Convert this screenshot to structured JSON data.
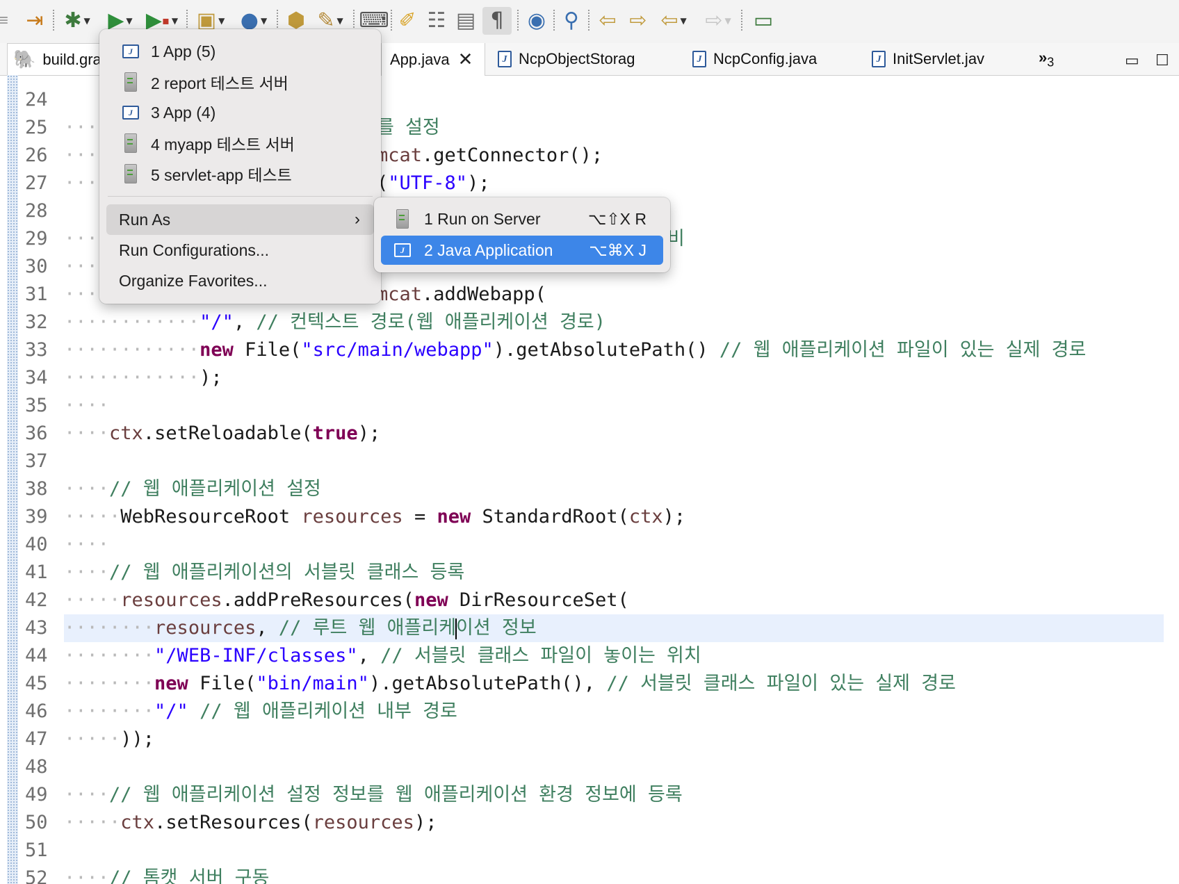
{
  "toolbar": {
    "buttons": [
      "skip-all-breakpoints-icon",
      "debug-icon",
      "run-icon",
      "run-external-tools-icon",
      "new-java-package-icon",
      "new-java-class-icon",
      "open-type-icon",
      "search-icon",
      "open-console-icon",
      "toggle-mark-occurrences-icon",
      "next-annotation-icon",
      "show-block-selection-icon",
      "show-whitespace-icon",
      "web-browser-icon",
      "pin-editor-icon",
      "last-edit-location-icon",
      "back-icon",
      "forward-icon"
    ]
  },
  "tabs": [
    {
      "label": "build.gra",
      "icon": "gradle-elephant-icon"
    },
    {
      "label": "App.java",
      "icon": "java-file-icon",
      "active": true
    },
    {
      "label": "NcpObjectStorag",
      "icon": "java-file-icon"
    },
    {
      "label": "NcpConfig.java",
      "icon": "java-file-icon"
    },
    {
      "label": "InitServlet.jav",
      "icon": "java-file-icon"
    }
  ],
  "tab_overflow": {
    "glyph": "»",
    "count": "3"
  },
  "editor": {
    "line_numbers": [
      "24",
      "25",
      "26",
      "27",
      "28",
      "29",
      "30",
      "31",
      "32",
      "33",
      "34",
      "35",
      "36",
      "37",
      "38",
      "39",
      "40",
      "41",
      "42",
      "43",
      "44",
      "45",
      "46",
      "47",
      "48",
      "49",
      "50",
      "51",
      "52"
    ],
    "peek": {
      "l25": "를 설정",
      "l26a": "mcat",
      "l26b": ".getConnector();",
      "l27a": "(",
      "l27b": "\"UTF-8\"",
      "l27c": ");",
      "l29": "비",
      "l31a": "mcat",
      "l31b": ".addWebapp("
    },
    "l32": {
      "s": "\"/\"",
      "p": ", ",
      "c": "// 컨텍스트 경로(웹 애플리케이션 경로)"
    },
    "l33": {
      "k": "new",
      "a": " File(",
      "s": "\"src/main/webapp\"",
      "b": ").getAbsolutePath() ",
      "c": "// 웹 애플리케이션 파일이 있는 실제 경로"
    },
    "l34": ");",
    "l36": {
      "f": "ctx",
      "a": ".setReloadable(",
      "k": "true",
      "b": ");"
    },
    "l38": "// 웹 애플리케이션 설정",
    "l39": {
      "a": "WebResourceRoot ",
      "f": "resources",
      "b": " = ",
      "k": "new",
      "c": " StandardRoot(",
      "f2": "ctx",
      "d": ");"
    },
    "l41": "// 웹 애플리케이션의 서블릿 클래스 등록",
    "l42": {
      "f": "resources",
      "a": ".addPreResources(",
      "k": "new",
      "b": " DirResourceSet("
    },
    "l43": {
      "f": "resources",
      "a": ", ",
      "c1": "// 루트 웹 애플리케",
      "c2": "이션 정보"
    },
    "l44": {
      "s": "\"/WEB-INF/classes\"",
      "a": ", ",
      "c": "// 서블릿 클래스 파일이 놓이는 위치"
    },
    "l45": {
      "k": "new",
      "a": " File(",
      "s": "\"bin/main\"",
      "b": ").getAbsolutePath(), ",
      "c": "// 서블릿 클래스 파일이 있는 실제 경로"
    },
    "l46": {
      "s": "\"/\"",
      "a": " ",
      "c": "// 웹 애플리케이션 내부 경로"
    },
    "l47": "));",
    "l49": "// 웹 애플리케이션 설정 정보를 웹 애플리케이션 환경 정보에 등록",
    "l50": {
      "f": "ctx",
      "a": ".setResources(",
      "f2": "resources",
      "b": ");"
    },
    "l52": "// 톰캣 서버 구동"
  },
  "run_menu": {
    "history": [
      {
        "label": "1 App (5)",
        "icon": "java-app-icon"
      },
      {
        "label": "2 report 테스트 서버",
        "icon": "server-icon"
      },
      {
        "label": "3 App (4)",
        "icon": "java-app-icon"
      },
      {
        "label": "4 myapp 테스트 서버",
        "icon": "server-icon"
      },
      {
        "label": "5 servlet-app 테스트",
        "icon": "server-icon"
      }
    ],
    "run_as": "Run As",
    "run_configurations": "Run Configurations...",
    "organize_favorites": "Organize Favorites..."
  },
  "run_as_submenu": [
    {
      "label": "1 Run on Server",
      "shortcut": "⌥⇧X R",
      "icon": "run-on-server-icon"
    },
    {
      "label": "2 Java Application",
      "shortcut": "⌥⌘X J",
      "icon": "java-app-icon",
      "selected": true
    }
  ]
}
